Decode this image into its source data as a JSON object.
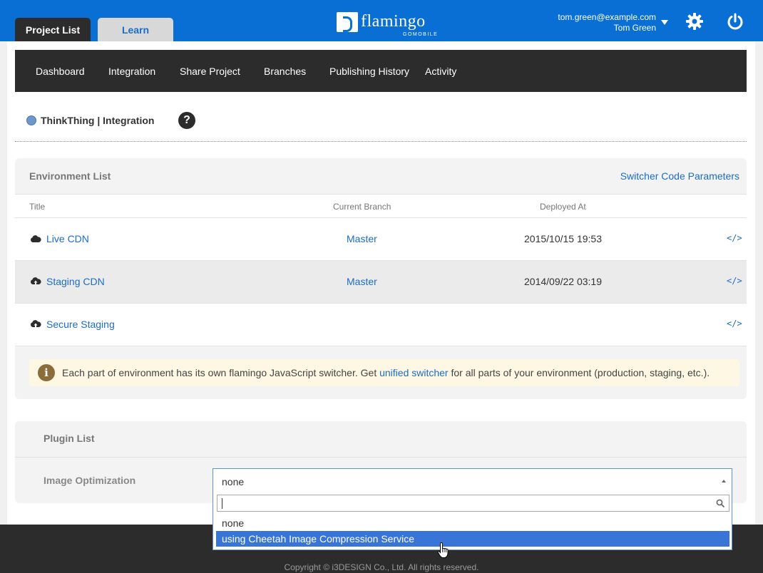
{
  "header": {
    "tabs": [
      {
        "label": "Project List"
      },
      {
        "label": "Learn"
      }
    ],
    "logo": {
      "word": "flamingo",
      "sub": "GOMOBILE"
    },
    "user": {
      "email": "tom.green@example.com",
      "name": "Tom Green"
    },
    "icons": [
      "caret-down-icon",
      "gear-icon",
      "power-icon"
    ],
    "brand_color": "#0a6fd5"
  },
  "subnav": {
    "items": [
      "Dashboard",
      "Integration",
      "Share Project",
      "Branches",
      "Publishing History",
      "Activity"
    ]
  },
  "breadcrumb": {
    "text": "ThinkThing | Integration",
    "help": "?"
  },
  "environments": {
    "title": "Environment List",
    "link": "Switcher Code Parameters",
    "columns": [
      "Title",
      "Current Branch",
      "Deployed At"
    ],
    "rows": [
      {
        "name": "Live CDN",
        "branch": "Master",
        "deployed": "2015/10/15 19:53",
        "code": "</>"
      },
      {
        "name": "Staging CDN",
        "branch": "Master",
        "deployed": "2014/09/22 03:19",
        "code": "</>"
      },
      {
        "name": "Secure Staging",
        "branch": "",
        "deployed": "",
        "code": "</>"
      }
    ],
    "notice": {
      "before": "Each part of environment has its own flamingo JavaScript switcher. Get ",
      "link": "unified switcher",
      "after": " for all parts of your environment (production, staging, etc.)."
    }
  },
  "plugins": {
    "title": "Plugin List",
    "label": "Image Optimization",
    "select": {
      "value": "none",
      "search": "",
      "options": [
        "none",
        "using Cheetah Image Compression Service"
      ],
      "highlighted": 1
    }
  },
  "footer": {
    "text": "Copyright © i3DESIGN Co., Ltd. All rights reserved."
  }
}
